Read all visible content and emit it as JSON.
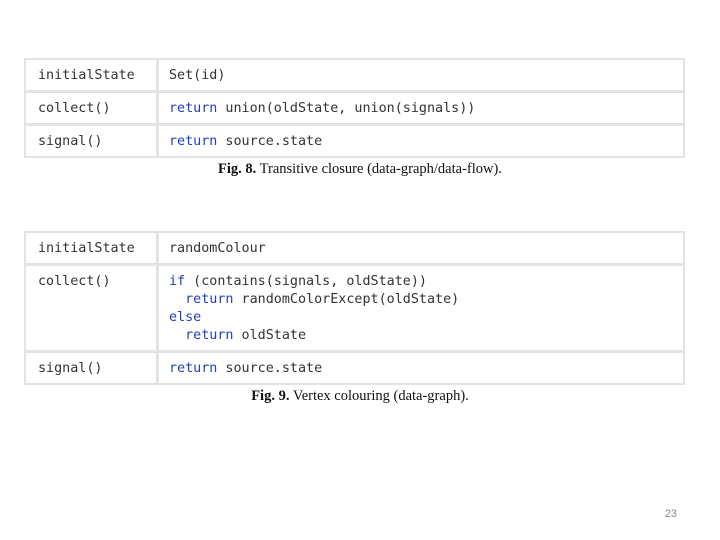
{
  "figure8": {
    "rows": [
      {
        "key": "initialState",
        "lines": [
          [
            {
              "t": "Set(id)",
              "kw": false
            }
          ]
        ]
      },
      {
        "key": "collect()",
        "lines": [
          [
            {
              "t": "return",
              "kw": true
            },
            {
              "t": " union(oldState, union(signals))",
              "kw": false
            }
          ]
        ]
      },
      {
        "key": "signal()",
        "lines": [
          [
            {
              "t": "return",
              "kw": true
            },
            {
              "t": " source.state",
              "kw": false
            }
          ]
        ]
      }
    ],
    "caption_label": "Fig. 8.",
    "caption_text": " Transitive closure (data-graph/data-flow)."
  },
  "figure9": {
    "rows": [
      {
        "key": "initialState",
        "lines": [
          [
            {
              "t": "randomColour",
              "kw": false
            }
          ]
        ]
      },
      {
        "key": "collect()",
        "lines": [
          [
            {
              "t": "if",
              "kw": true
            },
            {
              "t": " (contains(signals, oldState))",
              "kw": false
            }
          ],
          [
            {
              "t": "  ",
              "kw": false
            },
            {
              "t": "return",
              "kw": true
            },
            {
              "t": " randomColorExcept(oldState)",
              "kw": false
            }
          ],
          [
            {
              "t": "else",
              "kw": true
            }
          ],
          [
            {
              "t": "  ",
              "kw": false
            },
            {
              "t": "return",
              "kw": true
            },
            {
              "t": " oldState",
              "kw": false
            }
          ]
        ]
      },
      {
        "key": "signal()",
        "lines": [
          [
            {
              "t": "return",
              "kw": true
            },
            {
              "t": " source.state",
              "kw": false
            }
          ]
        ]
      }
    ],
    "caption_label": "Fig. 9.",
    "caption_text": " Vertex colouring (data-graph)."
  },
  "page_number": "23",
  "colors": {
    "keyword": "#2240b8",
    "code_text": "#333333",
    "table_border": "#e3e3e3"
  }
}
